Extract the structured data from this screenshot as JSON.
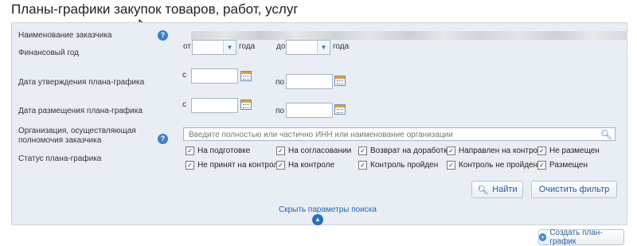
{
  "page_title": "Планы-графики закупок товаров, работ, услуг",
  "fields": {
    "customer_name_label": "Наименование заказчика",
    "fin_year_label": "Финансовый год",
    "from_label": "от",
    "year_label_1": "года",
    "to_label": "до",
    "year_label_2": "года",
    "approval_date_label": "Дата утверждения плана-графика",
    "placement_date_label": "Дата размещения плана-графика",
    "s_label_1": "с",
    "po_label_1": "по",
    "s_label_2": "с",
    "po_label_2": "по",
    "org_label": "Организация, осуществляющая полномочия заказчика",
    "org_placeholder": "Введите полностью или частично ИНН или наименование организации",
    "status_label": "Статус плана-графика"
  },
  "statuses": [
    {
      "label": "На подготовке",
      "checked": true
    },
    {
      "label": "На согласовании",
      "checked": true
    },
    {
      "label": "Возврат на доработку",
      "checked": true
    },
    {
      "label": "Направлен на контроль",
      "checked": true
    },
    {
      "label": "Не размещен",
      "checked": true
    },
    {
      "label": "Не принят на контроль",
      "checked": true
    },
    {
      "label": "На контроле",
      "checked": true
    },
    {
      "label": "Контроль пройден",
      "checked": true
    },
    {
      "label": "Контроль не пройден",
      "checked": true
    },
    {
      "label": "Размещен",
      "checked": true
    }
  ],
  "buttons": {
    "find": "Найти",
    "clear": "Очистить фильтр",
    "hide_params": "Скрыть параметры поиска",
    "create": "Создать план-график"
  },
  "icons": {
    "help": "question-icon",
    "calendar": "calendar-icon",
    "search": "search-icon",
    "dropdown": "chevron-down-icon"
  },
  "colors": {
    "accent": "#2a6fbe",
    "panel_bg": "#e8eef4"
  }
}
